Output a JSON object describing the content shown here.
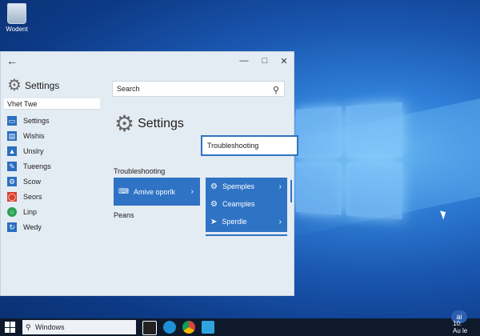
{
  "desktop": {
    "icon_label": "Wodent"
  },
  "window": {
    "back_icon": "arrow-left-icon",
    "controls": [
      "minimize-icon",
      "maximize-icon",
      "close-icon"
    ]
  },
  "sidebar": {
    "title": "Settings",
    "search_value": "Vhet Twe",
    "items": [
      {
        "label": "Settings",
        "icon": "display-icon",
        "color": "#2a6ebf"
      },
      {
        "label": "Wishis",
        "icon": "devices-icon",
        "color": "#2a6ebf"
      },
      {
        "label": "Unslry",
        "icon": "network-icon",
        "color": "#2a6ebf"
      },
      {
        "label": "Tueengs",
        "icon": "personalize-icon",
        "color": "#2a6ebf"
      },
      {
        "label": "Scow",
        "icon": "gear-icon",
        "color": "#2a6ebf"
      },
      {
        "label": "Seors",
        "icon": "privacy-icon",
        "color": "#d9412f"
      },
      {
        "label": "Linp",
        "icon": "globe-icon",
        "color": "#2aa052"
      },
      {
        "label": "Wedy",
        "icon": "update-icon",
        "color": "#2a6ebf"
      }
    ]
  },
  "main": {
    "search_placeholder": "Search",
    "title": "Settings",
    "troubleshooting_field": "Troubleshooting",
    "section_label": "Troubleshooting",
    "tile": {
      "label": "Amive oporlk",
      "icon": "keyboard-icon"
    },
    "secondary_label": "Peans",
    "dropdown": {
      "items": [
        {
          "label": "Spemples",
          "icon": "gear-icon"
        },
        {
          "label": "Ceamples",
          "icon": "gear-icon"
        },
        {
          "label": "Sperdle",
          "icon": "arrow-right-icon"
        }
      ]
    }
  },
  "taskbar": {
    "search_label": "Windows",
    "apps": [
      "file-explorer-icon",
      "edge-icon",
      "chrome-icon",
      "store-icon"
    ],
    "clock_line1": "10:",
    "clock_line2": "Au le",
    "badge": "ai"
  },
  "colors": {
    "accent": "#2f73c4",
    "taskbar": "#0e1a2b"
  }
}
